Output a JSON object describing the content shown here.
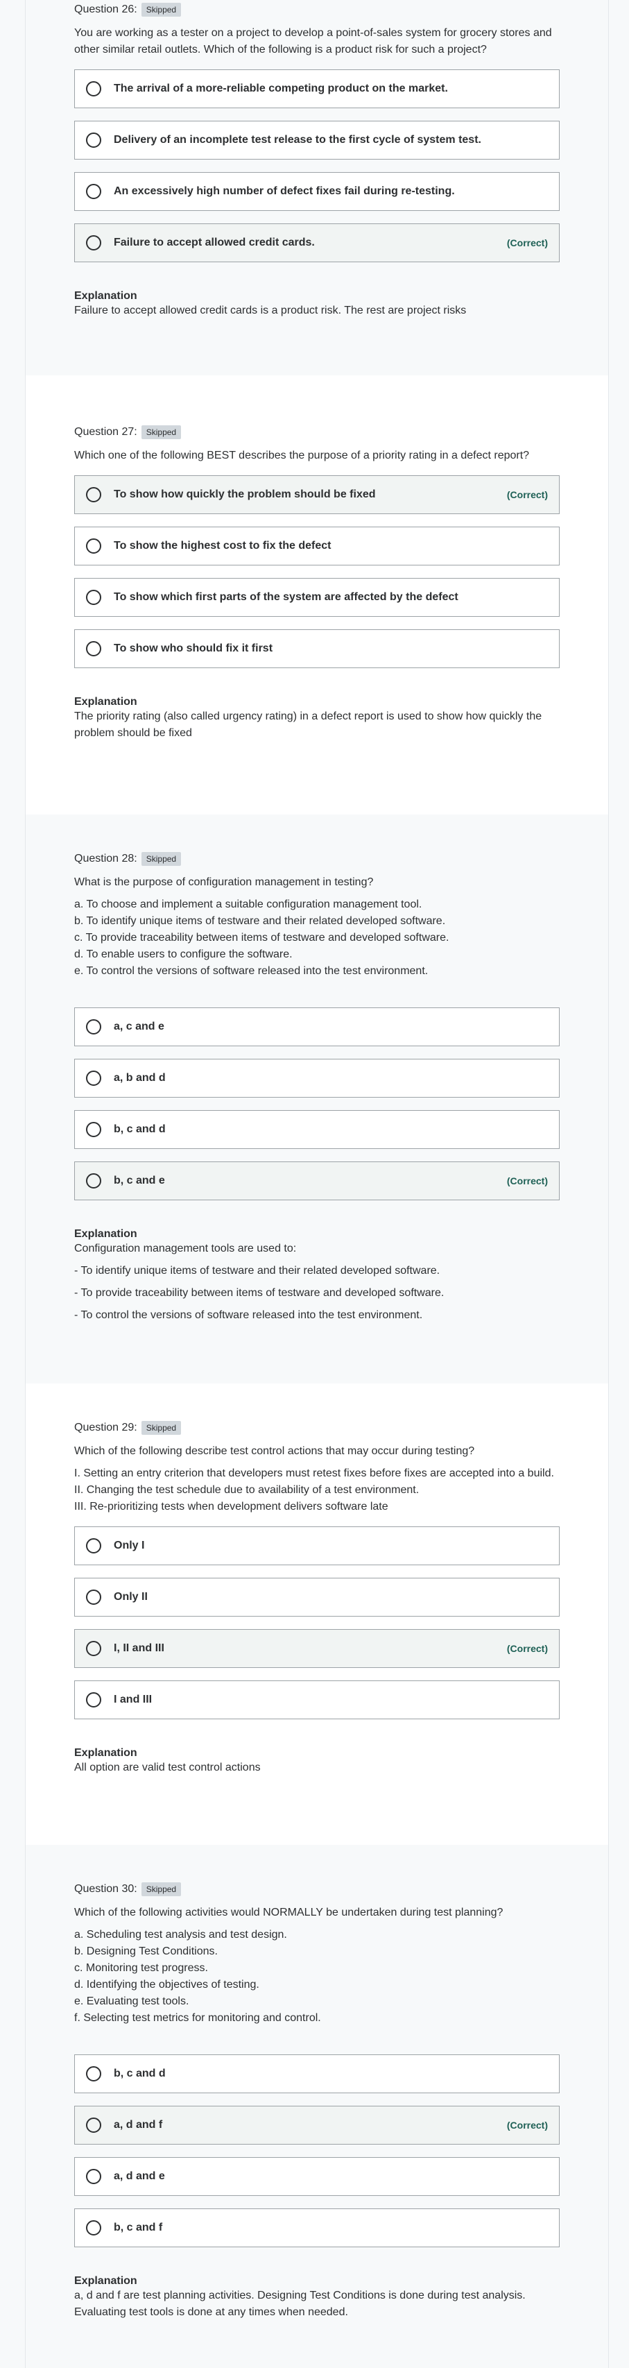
{
  "questions": [
    {
      "number_label": "Question 26:",
      "status": "Skipped",
      "text": "You are working as a tester on a project to develop a point-of-sales system for grocery stores and other similar retail outlets. Which of the following is a product risk for such a project?",
      "list": [],
      "options": [
        {
          "label": "The arrival of a more-reliable competing product on the market.",
          "correct": false
        },
        {
          "label": "Delivery of an incomplete test release to the first cycle of system test.",
          "correct": false
        },
        {
          "label": "An excessively high number of defect fixes fail during re-testing.",
          "correct": false
        },
        {
          "label": "Failure to accept allowed credit cards.",
          "correct": true
        }
      ],
      "explanation_title": "Explanation",
      "explanation": "Failure to accept allowed credit cards is a product risk. The rest are project risks",
      "explanation_items": []
    },
    {
      "number_label": "Question 27:",
      "status": "Skipped",
      "text": "Which one of the following BEST describes the purpose of a priority rating in a defect report?",
      "list": [],
      "options": [
        {
          "label": "To show how quickly the problem should be fixed",
          "correct": true
        },
        {
          "label": "To show the highest cost to fix the defect",
          "correct": false
        },
        {
          "label": "To show which first parts of the system are affected by the defect",
          "correct": false
        },
        {
          "label": "To show who should fix it first",
          "correct": false
        }
      ],
      "explanation_title": "Explanation",
      "explanation": "The priority rating (also called urgency rating) in a defect report is used to show how quickly the problem should be fixed",
      "explanation_items": []
    },
    {
      "number_label": "Question 28:",
      "status": "Skipped",
      "text": "What is the purpose of configuration management in testing?",
      "list": [
        "a. To choose and implement a suitable configuration management tool.",
        "b. To identify unique items of testware and their related developed software.",
        "c. To provide traceability between items of testware and developed software.",
        "d. To enable users to configure the software.",
        "e. To control the versions of software released into the test environment."
      ],
      "options": [
        {
          "label": "a, c and e",
          "correct": false
        },
        {
          "label": "a, b and d",
          "correct": false
        },
        {
          "label": "b, c and d",
          "correct": false
        },
        {
          "label": "b, c and e",
          "correct": true
        }
      ],
      "explanation_title": "Explanation",
      "explanation": "Configuration management tools are used to:",
      "explanation_items": [
        "- To identify unique items of testware and their related developed software.",
        "-  To provide traceability between items of testware and developed software.",
        "-  To control the versions of software released into the test environment."
      ]
    },
    {
      "number_label": "Question 29:",
      "status": "Skipped",
      "text": "Which of the following describe test control actions that may occur during testing?",
      "list": [
        "I. Setting an entry criterion that developers must retest fixes before fixes are accepted into a build.",
        "II. Changing the test schedule due to availability of a test environment.",
        "III. Re-prioritizing tests when development delivers software late"
      ],
      "options": [
        {
          "label": "Only I",
          "correct": false
        },
        {
          "label": "Only II",
          "correct": false
        },
        {
          "label": "I, II and III",
          "correct": true
        },
        {
          "label": "I and III",
          "correct": false
        }
      ],
      "explanation_title": "Explanation",
      "explanation": "All option are valid test control actions",
      "explanation_items": []
    },
    {
      "number_label": "Question 30:",
      "status": "Skipped",
      "text": "Which of the following activities would NORMALLY be undertaken during test planning?",
      "list": [
        "a. Scheduling test analysis and test design.",
        "b. Designing Test Conditions.",
        "c. Monitoring test progress.",
        "d. Identifying the objectives of testing.",
        "e. Evaluating test tools.",
        "f. Selecting test metrics for monitoring and control."
      ],
      "options": [
        {
          "label": "b, c and d",
          "correct": false
        },
        {
          "label": "a, d and f",
          "correct": true
        },
        {
          "label": "a, d and e",
          "correct": false
        },
        {
          "label": "b, c and f",
          "correct": false
        }
      ],
      "explanation_title": "Explanation",
      "explanation": "a, d and f are test planning activities. Designing Test Conditions is done during test analysis. Evaluating test tools is done at any times when needed.",
      "explanation_items": []
    }
  ],
  "correct_label": "(Correct)"
}
